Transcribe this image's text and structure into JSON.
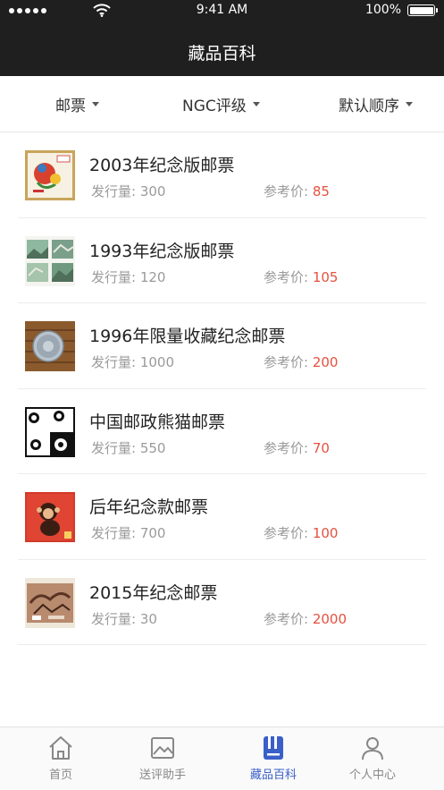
{
  "status_bar": {
    "time": "9:41 AM",
    "battery": "100%"
  },
  "nav": {
    "title": "藏品百科"
  },
  "filters": [
    {
      "label": "邮票"
    },
    {
      "label": "NGC评级"
    },
    {
      "label": "默认顺序"
    }
  ],
  "labels": {
    "issue": "发行量:",
    "price": "参考价:"
  },
  "items": [
    {
      "title": "2003年纪念版邮票",
      "issue": "300",
      "price": "85"
    },
    {
      "title": "1993年纪念版邮票",
      "issue": "120",
      "price": "105"
    },
    {
      "title": "1996年限量收藏纪念邮票",
      "issue": "1000",
      "price": "200"
    },
    {
      "title": "中国邮政熊猫邮票",
      "issue": "550",
      "price": "70"
    },
    {
      "title": "后年纪念款邮票",
      "issue": "700",
      "price": "100"
    },
    {
      "title": "2015年纪念邮票",
      "issue": "30",
      "price": "2000"
    }
  ],
  "tabs": [
    {
      "label": "首页",
      "icon": "home-icon"
    },
    {
      "label": "送评助手",
      "icon": "image-icon"
    },
    {
      "label": "藏品百科",
      "icon": "book-icon"
    },
    {
      "label": "个人中心",
      "icon": "person-icon"
    }
  ],
  "colors": {
    "accent": "#3a5fc8",
    "price": "#e5513f",
    "header": "#1f1f1f"
  }
}
